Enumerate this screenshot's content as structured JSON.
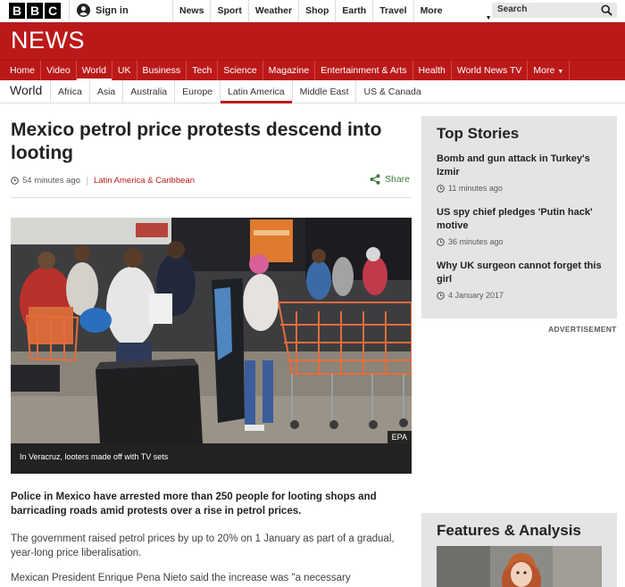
{
  "masthead": {
    "logo_letters": [
      "B",
      "B",
      "C"
    ],
    "signin_label": "Sign in",
    "nav": [
      "News",
      "Sport",
      "Weather",
      "Shop",
      "Earth",
      "Travel"
    ],
    "more_label": "More",
    "search_placeholder": "Search"
  },
  "banner": {
    "title": "NEWS"
  },
  "main_nav": {
    "items": [
      "Home",
      "Video",
      "World",
      "UK",
      "Business",
      "Tech",
      "Science",
      "Magazine",
      "Entertainment & Arts",
      "Health",
      "World News TV",
      "More"
    ],
    "active": "World"
  },
  "sub_nav": {
    "section": "World",
    "items": [
      "Africa",
      "Asia",
      "Australia",
      "Europe",
      "Latin America",
      "Middle East",
      "US & Canada"
    ],
    "active": "Latin America"
  },
  "article": {
    "headline": "Mexico petrol price protests descend into looting",
    "timestamp": "54 minutes ago",
    "topic": "Latin America & Caribbean",
    "share_label": "Share",
    "image_credit": "EPA",
    "caption": "In Veracruz, looters made off with TV sets",
    "lede": "Police in Mexico have arrested more than 250 people for looting shops and barricading roads amid protests over a rise in petrol prices.",
    "paragraphs": [
      "The government raised petrol prices by up to 20% on 1 January as part of a gradual, year-long price liberalisation.",
      "Mexican President Enrique Pena Nieto said the increase was \"a necessary"
    ]
  },
  "sidebar": {
    "top_stories_title": "Top Stories",
    "stories": [
      {
        "title": "Bomb and gun attack in Turkey's Izmir",
        "time": "11 minutes ago"
      },
      {
        "title": "US spy chief pledges 'Putin hack' motive",
        "time": "36 minutes ago"
      },
      {
        "title": "Why UK surgeon cannot forget this girl",
        "time": "4 January 2017"
      }
    ],
    "advertisement_label": "ADVERTISEMENT",
    "features_title": "Features & Analysis"
  },
  "colors": {
    "brand_red": "#bb1919",
    "share_green": "#3f7c3a",
    "sidebar_grey": "#e4e4e4"
  }
}
